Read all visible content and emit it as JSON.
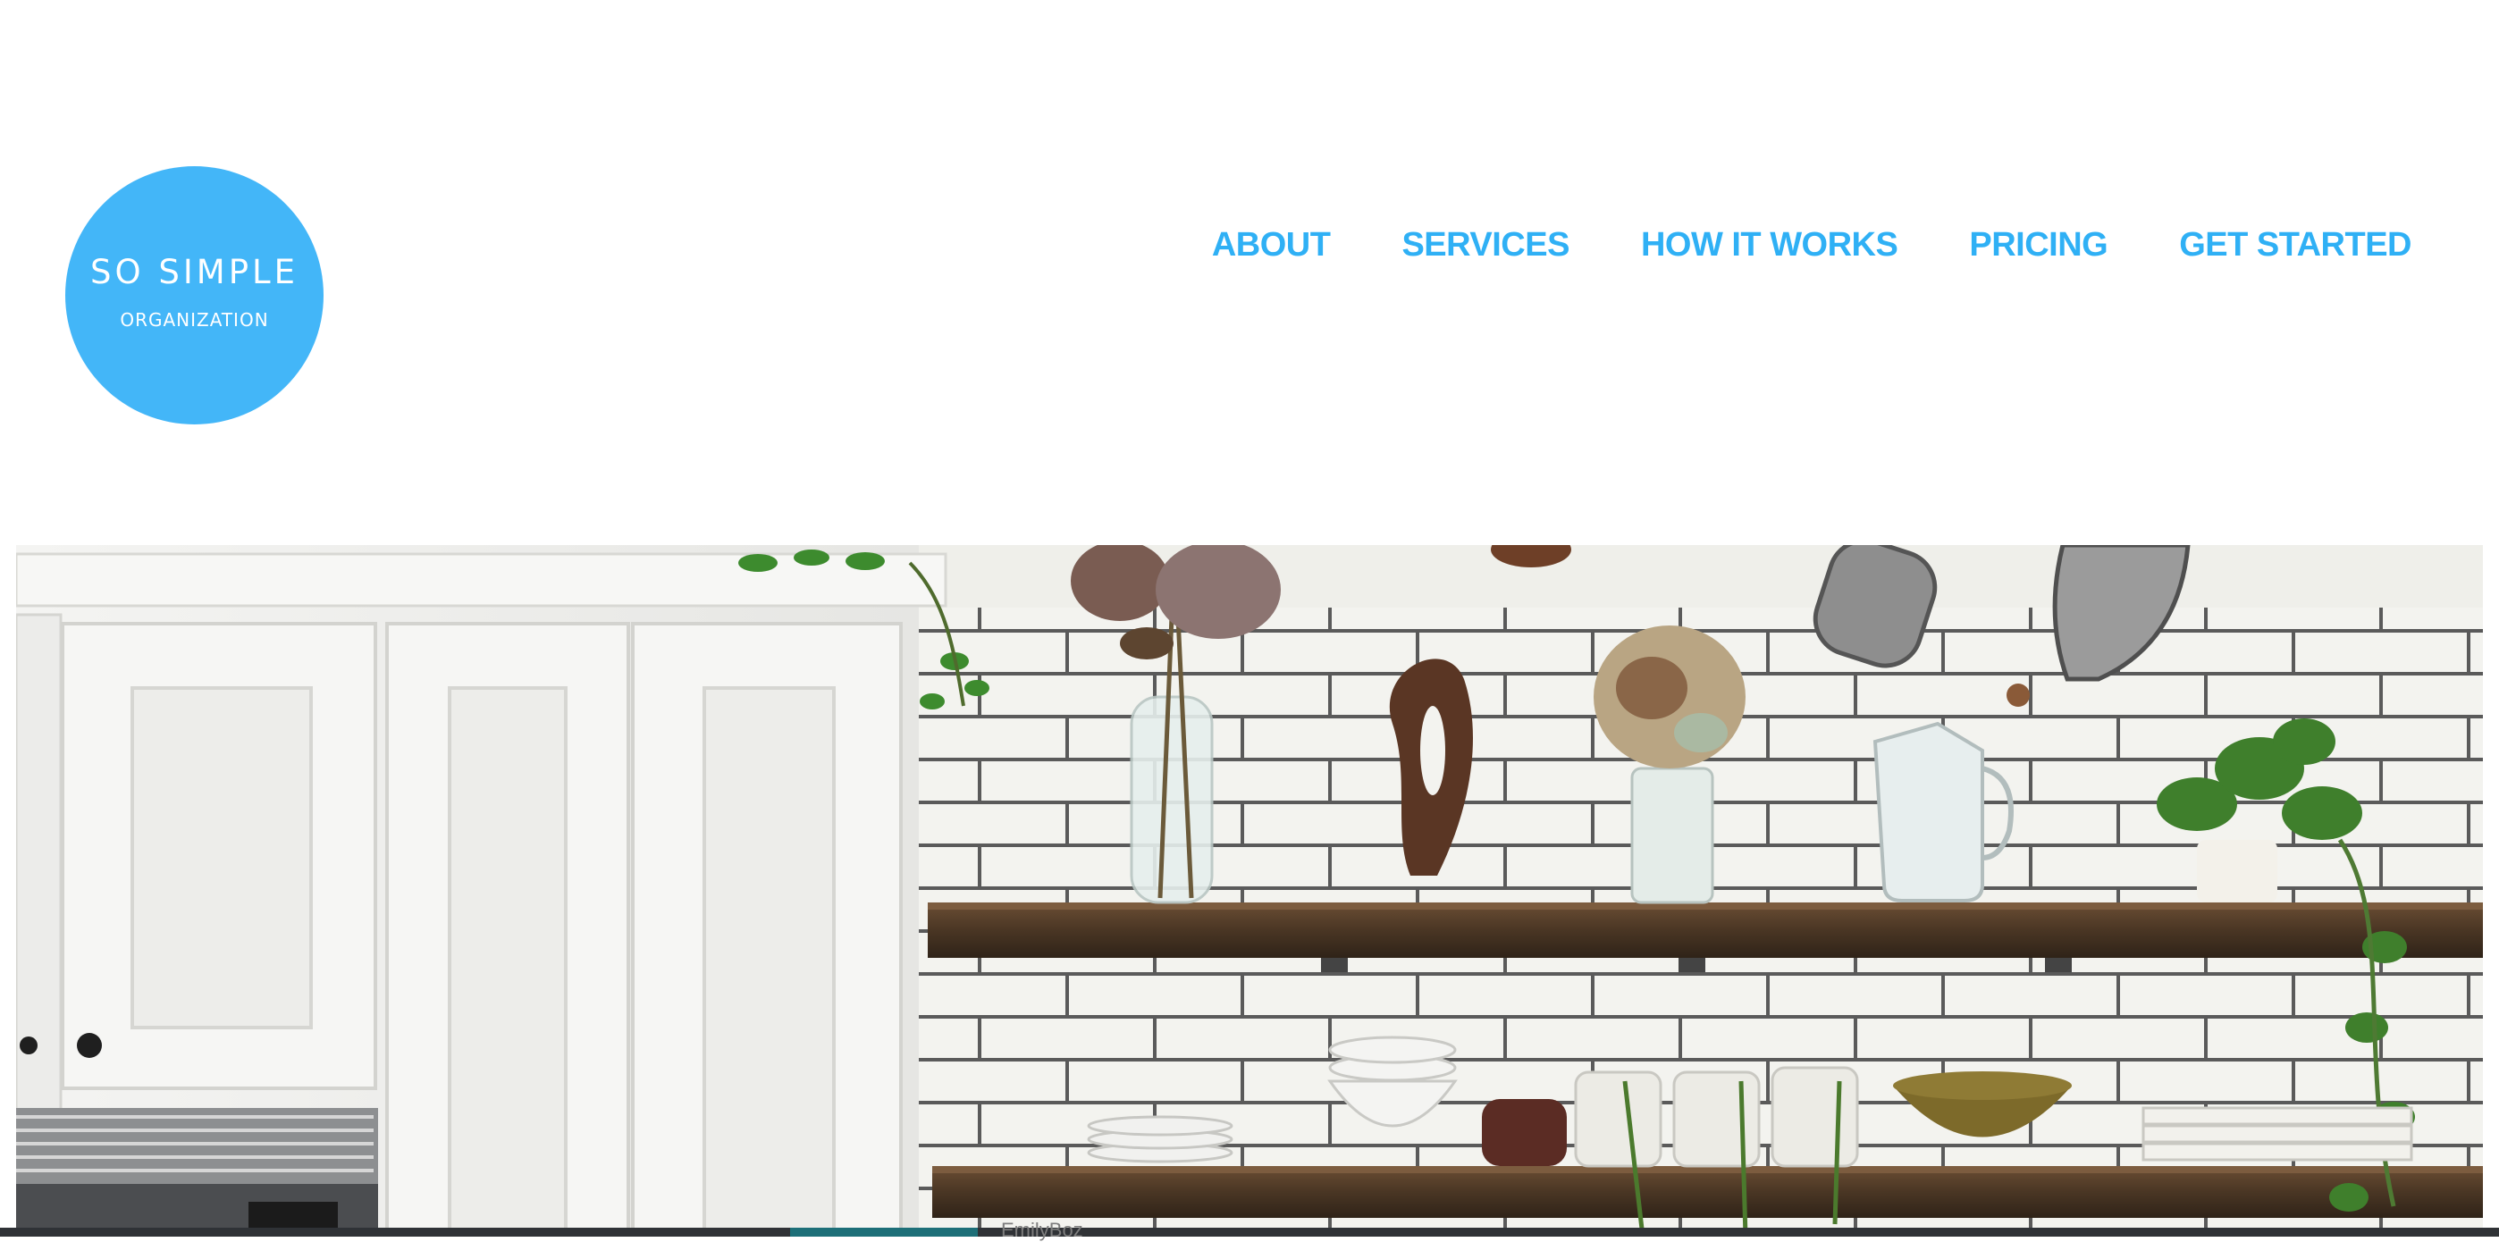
{
  "logo": {
    "title": "SO SIMPLE",
    "subtitle": "ORGANIZATION",
    "color": "#43b6f8"
  },
  "nav": {
    "color": "#2fb0f5",
    "items": [
      {
        "label": "ABOUT"
      },
      {
        "label": "SERVICES"
      },
      {
        "label": "HOW IT WORKS"
      },
      {
        "label": "PRICING"
      },
      {
        "label": "GET STARTED"
      }
    ]
  },
  "hero": {
    "image": "kitchen-shelves-photo"
  },
  "taskbar": {
    "label": "EmilyBoz"
  }
}
